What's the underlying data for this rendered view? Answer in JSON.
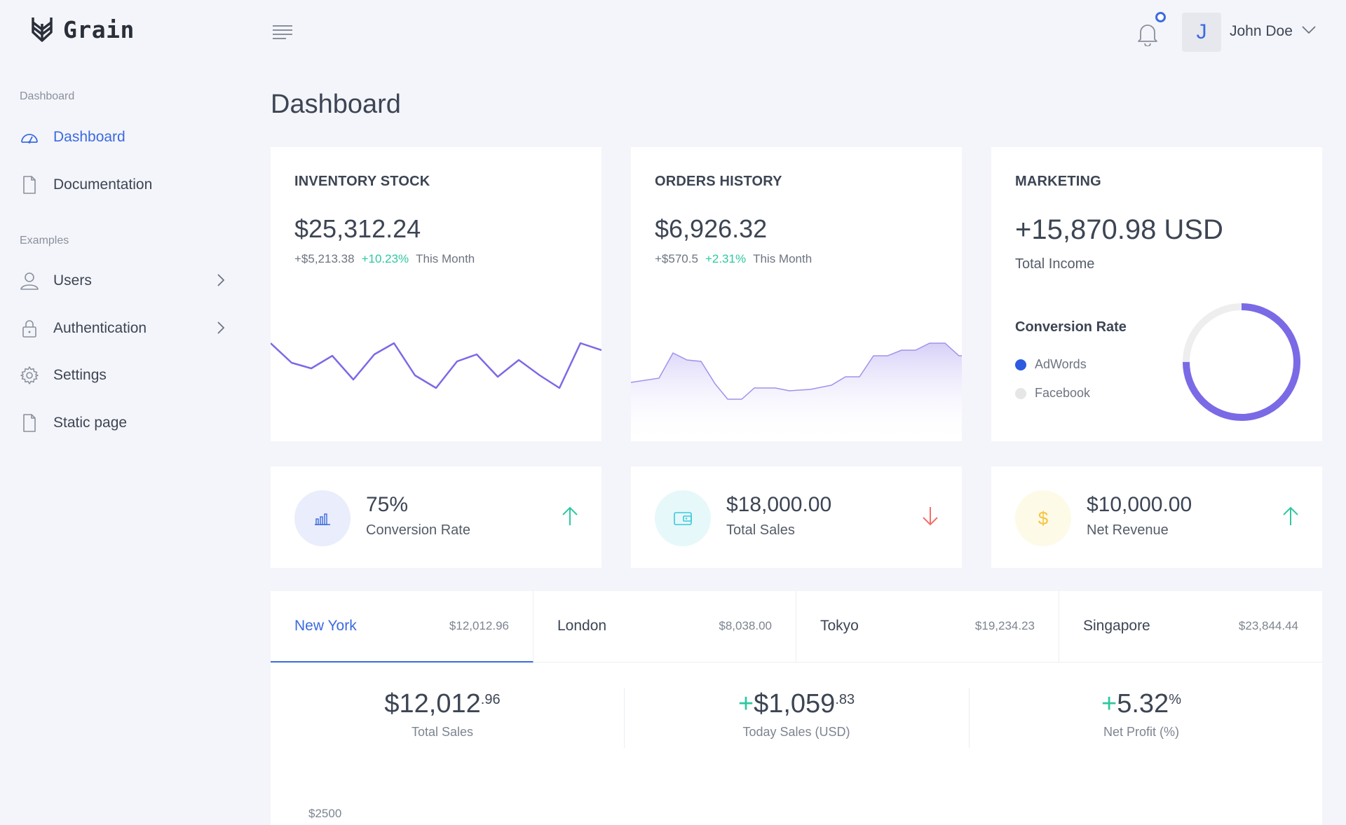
{
  "app": {
    "name": "Grain"
  },
  "sidebar": {
    "sections": [
      {
        "label": "Dashboard"
      },
      {
        "label": "Examples"
      }
    ],
    "items": [
      {
        "label": "Dashboard",
        "icon": "gauge-icon",
        "active": true
      },
      {
        "label": "Documentation",
        "icon": "file-icon"
      },
      {
        "label": "Users",
        "icon": "user-icon"
      },
      {
        "label": "Authentication",
        "icon": "lock-icon"
      },
      {
        "label": "Settings",
        "icon": "gear-icon"
      },
      {
        "label": "Static page",
        "icon": "file-icon"
      }
    ]
  },
  "header": {
    "user_initial": "J",
    "user_name": "John Doe"
  },
  "page": {
    "title": "Dashboard"
  },
  "cards": {
    "inventory": {
      "title": "INVENTORY STOCK",
      "value": "$25,312.24",
      "delta": "+$5,213.38",
      "pct": "+10.23%",
      "period": "This Month"
    },
    "orders": {
      "title": "ORDERS HISTORY",
      "value": "$6,926.32",
      "delta": "+$570.5",
      "pct": "+2.31%",
      "period": "This Month"
    },
    "marketing": {
      "title": "MARKETING",
      "value": "+15,870.98 USD",
      "sub": "Total Income",
      "conversion_title": "Conversion Rate",
      "legend": [
        {
          "label": "AdWords",
          "color": "#2c5be0"
        },
        {
          "label": "Facebook",
          "color": "#e6e6e6"
        }
      ],
      "adwords_share": 0.75
    }
  },
  "stats": [
    {
      "value": "75%",
      "label": "Conversion Rate",
      "icon": "bar-chart-icon",
      "trend": "up"
    },
    {
      "value": "$18,000.00",
      "label": "Total Sales",
      "icon": "wallet-icon",
      "trend": "down"
    },
    {
      "value": "$10,000.00",
      "label": "Net Revenue",
      "icon": "dollar-icon",
      "trend": "up"
    }
  ],
  "tabs": [
    {
      "label": "New York",
      "amount": "$12,012.96",
      "active": true
    },
    {
      "label": "London",
      "amount": "$8,038.00"
    },
    {
      "label": "Tokyo",
      "amount": "$19,234.23"
    },
    {
      "label": "Singapore",
      "amount": "$23,844.44"
    }
  ],
  "metrics": [
    {
      "prefix": "",
      "main": "$12,012",
      "sup": ".96",
      "label": "Total Sales"
    },
    {
      "prefix": "+",
      "main": "$1,059",
      "sup": ".83",
      "label": "Today Sales (USD)"
    },
    {
      "prefix": "+",
      "main": "5.32",
      "sup": "%",
      "label": "Net Profit (%)"
    }
  ],
  "chart": {
    "y_tick_top": "$2500"
  },
  "colors": {
    "accent": "#3b6ae0",
    "chart_line": "#7b6ae6",
    "positive": "#2ec8a0",
    "negative": "#f0706a",
    "warning": "#f5c542"
  }
}
